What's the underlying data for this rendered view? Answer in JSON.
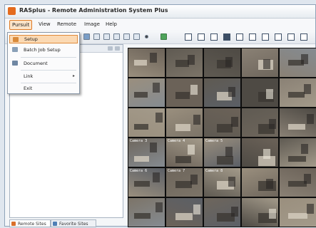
{
  "window": {
    "title": "RASplus - Remote Administration System Plus"
  },
  "menubar": {
    "items": [
      "Pursuit",
      "View",
      "Remote",
      "Image",
      "Help"
    ]
  },
  "file_menu": {
    "items": [
      {
        "label": "Setup",
        "has_submenu": false
      },
      {
        "label": "Batch Job Setup",
        "has_submenu": false
      },
      {
        "label": "Document",
        "has_submenu": false
      },
      {
        "label": "Link",
        "has_submenu": true
      },
      {
        "label": "Exit",
        "has_submenu": false
      }
    ],
    "submenu_arrow": "▸"
  },
  "left_panel": {
    "tabs": [
      "Remote Sites",
      "Favorite Sites"
    ]
  },
  "video_grid": {
    "camera_labels": [
      "Camera 3",
      "Camera 4",
      "Camera 5",
      "Camera 6",
      "Camera 7",
      "Camera 8"
    ]
  },
  "colors": {
    "accent": "#e07a24",
    "menu_highlight": "#fbd9b3"
  }
}
